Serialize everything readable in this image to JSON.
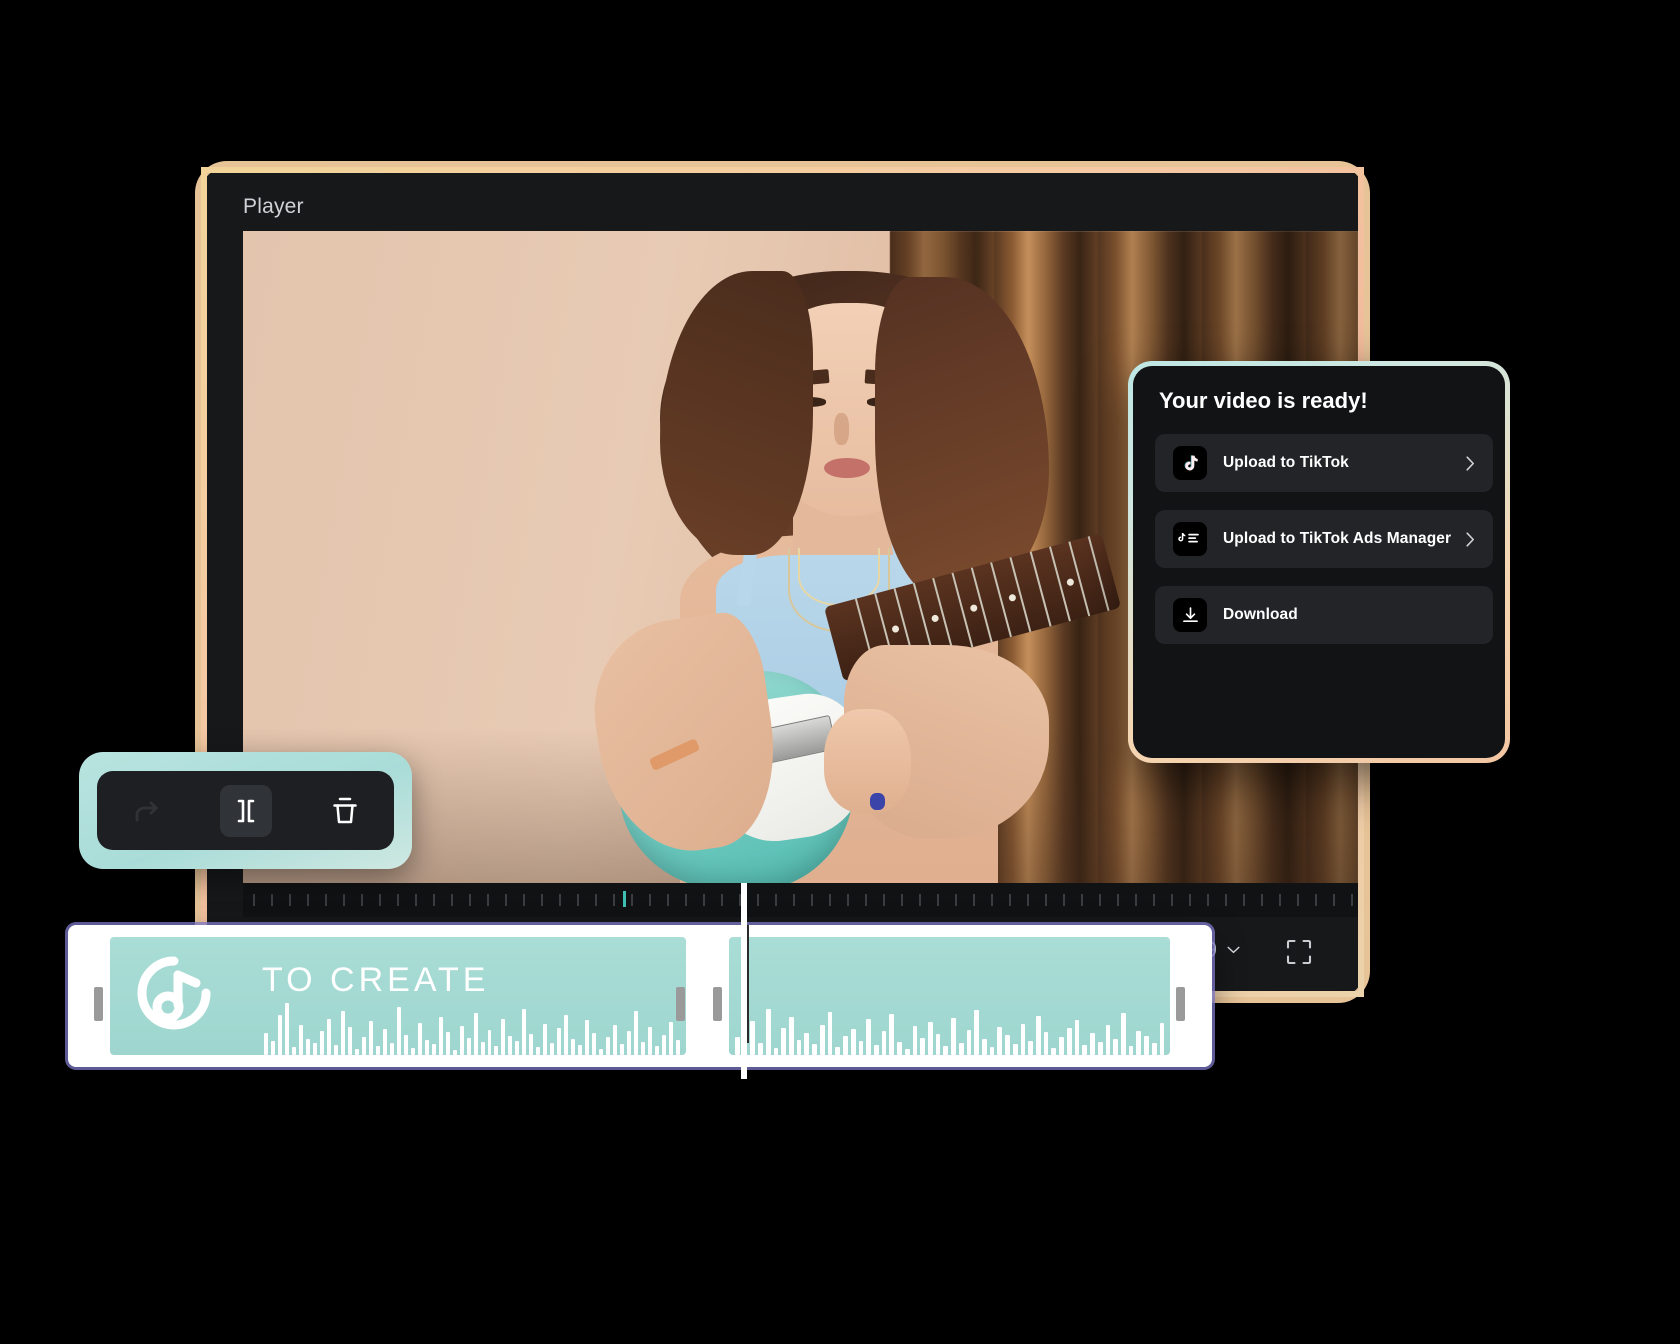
{
  "player": {
    "title": "Player",
    "aspect_ratio": "16:9",
    "aspect_chevron_icon": "chevron-down-icon",
    "fullscreen_icon": "fullscreen-icon"
  },
  "export_panel": {
    "title": "Your video is ready!",
    "rows": [
      {
        "label": "Upload to TikTok",
        "icon": "tiktok-icon",
        "chevron": "chevron-right-icon"
      },
      {
        "label": "Upload to TikTok Ads Manager",
        "icon": "tiktok-ads-manager-icon",
        "chevron": "chevron-right-icon"
      },
      {
        "label": "Download",
        "icon": "download-icon",
        "chevron": ""
      }
    ]
  },
  "toolbar": {
    "buttons": [
      {
        "name": "redo-icon",
        "label": "Redo",
        "active": false
      },
      {
        "name": "split-icon",
        "label": "Split",
        "active": true
      },
      {
        "name": "trash-icon",
        "label": "Delete",
        "active": false
      }
    ]
  },
  "timeline": {
    "clip_label": "TO CREATE",
    "music_icon": "music-note-icon",
    "clips": [
      {
        "id": "clip-a",
        "label": "TO CREATE"
      },
      {
        "id": "clip-b",
        "label": ""
      }
    ],
    "waveform_a": [
      22,
      14,
      40,
      52,
      8,
      30,
      16,
      12,
      24,
      36,
      10,
      44,
      28,
      6,
      18,
      34,
      9,
      26,
      12,
      48,
      20,
      7,
      32,
      15,
      11,
      38,
      23,
      5,
      29,
      17,
      42,
      13,
      25,
      9,
      36,
      19,
      14,
      46,
      21,
      8,
      31,
      12,
      27,
      40,
      16,
      10,
      35,
      22,
      6,
      18,
      30,
      11,
      24,
      44,
      13,
      28,
      9,
      20,
      33,
      15
    ],
    "waveform_b": [
      18,
      9,
      34,
      12,
      46,
      7,
      27,
      38,
      15,
      22,
      11,
      30,
      43,
      8,
      19,
      26,
      14,
      36,
      10,
      24,
      41,
      13,
      6,
      29,
      17,
      33,
      21,
      9,
      37,
      12,
      25,
      45,
      16,
      8,
      28,
      20,
      11,
      31,
      14,
      39,
      23,
      7,
      18,
      27,
      35,
      10,
      22,
      13,
      30,
      16,
      42,
      9,
      24,
      19,
      12,
      32
    ]
  }
}
